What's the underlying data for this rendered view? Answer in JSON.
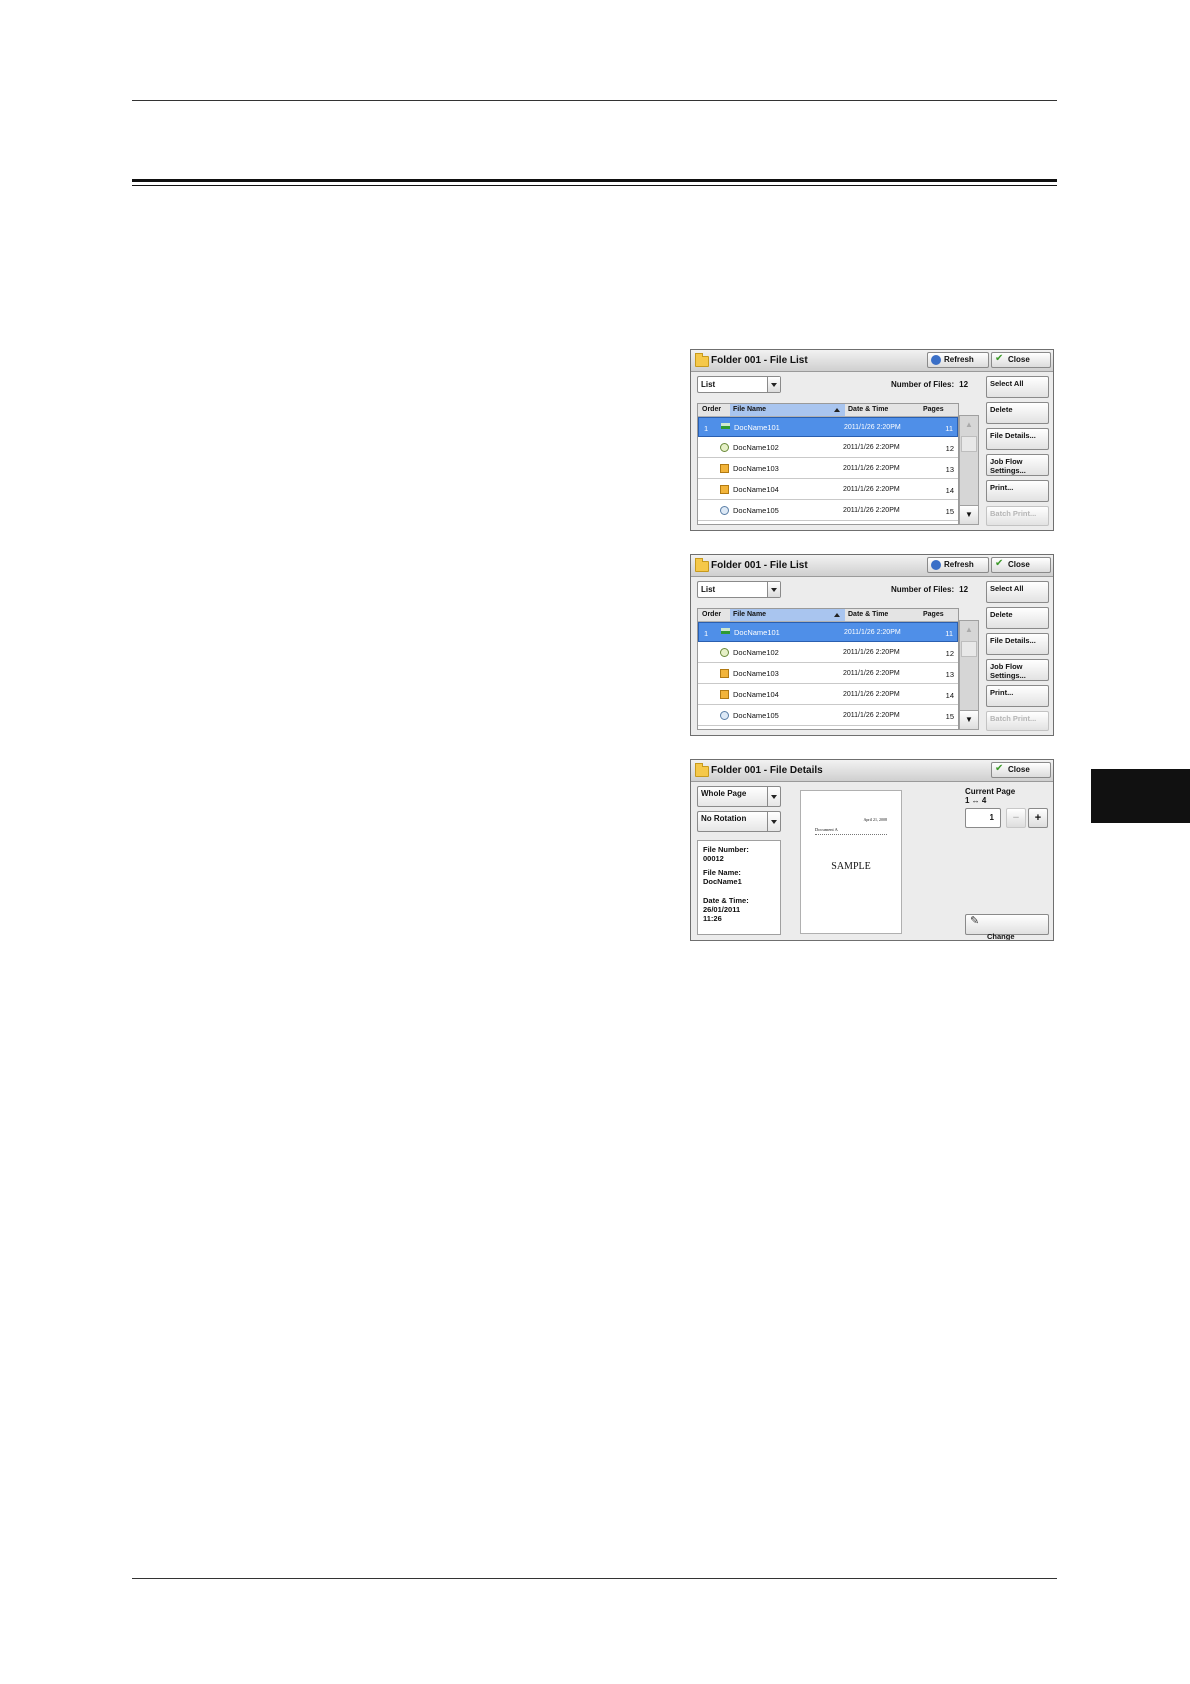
{
  "file_list_panel": {
    "title": "Folder 001 - File List",
    "refresh_label": "Refresh",
    "close_label": "Close",
    "view_select": "List",
    "number_of_files_label": "Number of Files:",
    "number_of_files_value": "12",
    "columns": {
      "order": "Order",
      "file_name": "File Name",
      "date_time": "Date & Time",
      "pages": "Pages"
    },
    "rows": [
      {
        "order": "1",
        "icon": "scanner-icon",
        "name": "DocName101",
        "date": "2011/1/26  2:20PM",
        "pages": "11",
        "selected": true
      },
      {
        "order": "",
        "icon": "document-icon",
        "name": "DocName102",
        "date": "2011/1/26  2:20PM",
        "pages": "12",
        "selected": false
      },
      {
        "order": "",
        "icon": "folder-document-icon",
        "name": "DocName103",
        "date": "2011/1/26  2:20PM",
        "pages": "13",
        "selected": false
      },
      {
        "order": "",
        "icon": "folder-document-icon",
        "name": "DocName104",
        "date": "2011/1/26  2:20PM",
        "pages": "14",
        "selected": false
      },
      {
        "order": "",
        "icon": "gear-document-icon",
        "name": "DocName105",
        "date": "2011/1/26  2:20PM",
        "pages": "15",
        "selected": false
      }
    ],
    "side_buttons": {
      "select_all": "Select All",
      "delete": "Delete",
      "file_details": "File Details...",
      "job_flow_settings": "Job Flow\nSettings...",
      "print": "Print...",
      "batch_print": "Batch Print..."
    }
  },
  "file_details_panel": {
    "title": "Folder 001 - File Details",
    "close_label": "Close",
    "view_select": "Whole Page",
    "rotation_select": "No Rotation",
    "file_number_label": "File Number:",
    "file_number_value": "00012",
    "file_name_label": "File Name:",
    "file_name_value": "DocName1",
    "date_time_label": "Date & Time:",
    "date_time_value_date": "26/01/2011",
    "date_time_value_time": "11:26",
    "preview": {
      "date": "April 21, 2008",
      "doc": "Document A",
      "sample": "SAMPLE"
    },
    "current_page_label": "Current Page",
    "current_page_range": "1 ↔ 4",
    "current_page_value": "1",
    "minus_label": "−",
    "plus_label": "+",
    "change_file_name_label": "Change\nFile Name..."
  }
}
